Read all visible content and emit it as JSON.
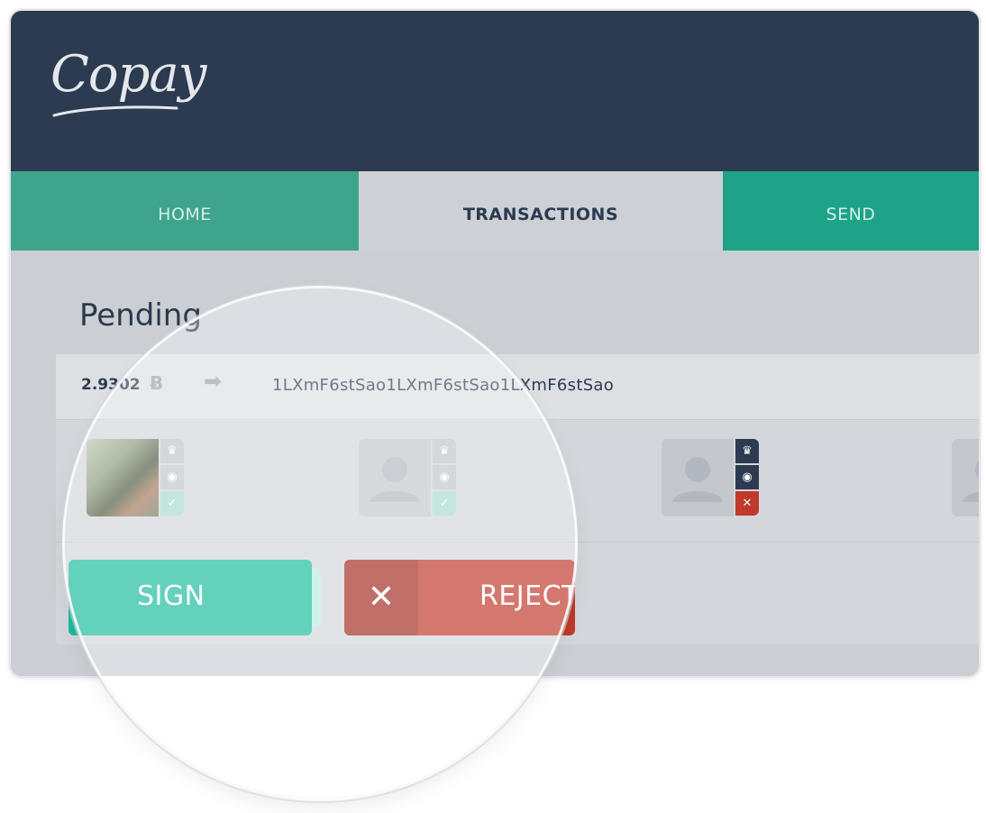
{
  "app": {
    "logo_text": "Copay"
  },
  "tabs": [
    {
      "label": "HOME"
    },
    {
      "label": "TRANSACTIONS"
    },
    {
      "label": "SEND"
    }
  ],
  "pending": {
    "title": "Pending",
    "transaction": {
      "amount": "2.9302",
      "currency_symbol": "Ƀ",
      "address": "1LXmF6stSao1LXmF6stSao1LXmF6stSao"
    },
    "copayers": [
      {
        "avatar": "photo",
        "statuses": [
          "crown-icon",
          "eye-icon",
          "check-icon"
        ],
        "colors": [
          "#c2c6cb",
          "#c2c6cb",
          "#a8dccd"
        ]
      },
      {
        "avatar": "placeholder",
        "statuses": [
          "crown-icon",
          "eye-icon",
          "check-icon"
        ],
        "colors": [
          "#c2c6cb",
          "#c2c6cb",
          "#a8dccd"
        ]
      },
      {
        "avatar": "placeholder",
        "statuses": [
          "crown-icon",
          "eye-icon",
          "close-icon"
        ],
        "colors": [
          "#2c3b50",
          "#2c3b50",
          "#c0392b"
        ]
      },
      {
        "avatar": "placeholder",
        "statuses": [],
        "colors": []
      }
    ],
    "actions": {
      "sign_label": "SIGN",
      "reject_label": "REJECT",
      "reject_icon": "close-icon"
    }
  },
  "colors": {
    "header": "#2c3b50",
    "tab_home": "#3ea58c",
    "tab_active": "#cdd1d6",
    "tab_send": "#1ea388",
    "sign": "#1abc9c",
    "reject": "#c0392b"
  }
}
